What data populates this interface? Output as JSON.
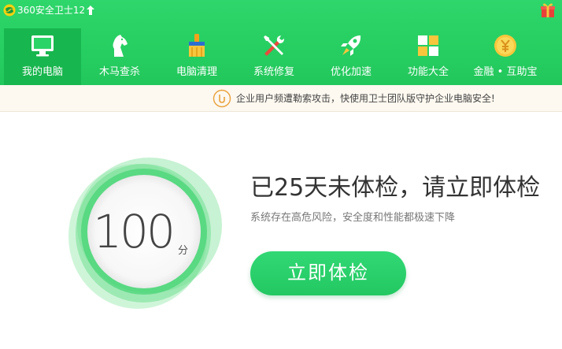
{
  "app": {
    "title": "360安全卫士12"
  },
  "nav": {
    "items": [
      {
        "label": "我的电脑",
        "icon": "monitor-icon",
        "active": true
      },
      {
        "label": "木马查杀",
        "icon": "horse-icon",
        "active": false
      },
      {
        "label": "电脑清理",
        "icon": "broom-icon",
        "active": false
      },
      {
        "label": "系统修复",
        "icon": "tools-icon",
        "active": false
      },
      {
        "label": "优化加速",
        "icon": "rocket-icon",
        "active": false
      },
      {
        "label": "功能大全",
        "icon": "grid-icon",
        "active": false
      },
      {
        "label": "金融 • 互助宝",
        "icon": "coin-icon",
        "active": false
      }
    ]
  },
  "notice": {
    "text": "企业用户频遭勒索攻击，快使用卫士团队版守护企业电脑安全!"
  },
  "score": {
    "value": "100",
    "unit": "分"
  },
  "main": {
    "headline": "已25天未体检，请立即体检",
    "subline": "系统存在高危风险，安全度和性能都极速下降",
    "button_label": "立即体检"
  },
  "colors": {
    "brand_green": "#27cf62",
    "active_nav": "#18b64e",
    "notice_bg": "#fdf8f0"
  }
}
